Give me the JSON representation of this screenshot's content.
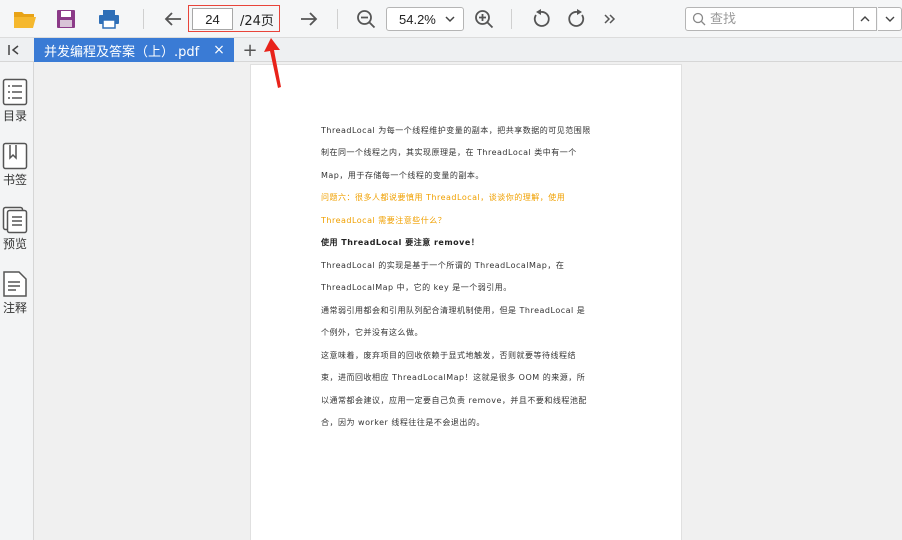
{
  "toolbar": {
    "page_current": "24",
    "page_total": "/24页",
    "zoom": "54.2%",
    "search_placeholder": "查找"
  },
  "tab": {
    "label": "并发编程及答案（上）.pdf",
    "close": "×",
    "add": "+"
  },
  "sidebar": {
    "items": [
      {
        "label": "目录",
        "icon": "toc-icon"
      },
      {
        "label": "书签",
        "icon": "bookmark-icon"
      },
      {
        "label": "预览",
        "icon": "thumbnails-icon"
      },
      {
        "label": "注释",
        "icon": "annotation-icon"
      }
    ]
  },
  "document": {
    "lines": [
      "ThreadLocal 为每一个线程维护变量的副本，把共享数据的可见范围限",
      "制在同一个线程之内，其实现原理是，在 ThreadLocal 类中有一个",
      "Map，用于存储每一个线程的变量的副本。",
      "问题六：很多人都说要慎用 ThreadLocal，谈谈你的理解，使用",
      "ThreadLocal 需要注意些什么？",
      "使用 ThreadLocal 要注意 remove！",
      "ThreadLocal 的实现是基于一个所谓的 ThreadLocalMap，在",
      "ThreadLocalMap 中，它的 key 是一个弱引用。",
      "通常弱引用都会和引用队列配合清理机制使用，但是 ThreadLocal 是",
      "个例外，它并没有这么做。",
      "这意味着，废弃项目的回收依赖于显式地触发，否则就要等待线程结",
      "束，进而回收相应 ThreadLocalMap！这就是很多 OOM 的来源，所",
      "以通常都会建议，应用一定要自己负责 remove，并且不要和线程池配",
      "合，因为 worker 线程往往是不会退出的。"
    ]
  },
  "colors": {
    "accent": "#3a7bd5",
    "highlight_red": "#e8443a",
    "orange_text": "#f0a000"
  }
}
